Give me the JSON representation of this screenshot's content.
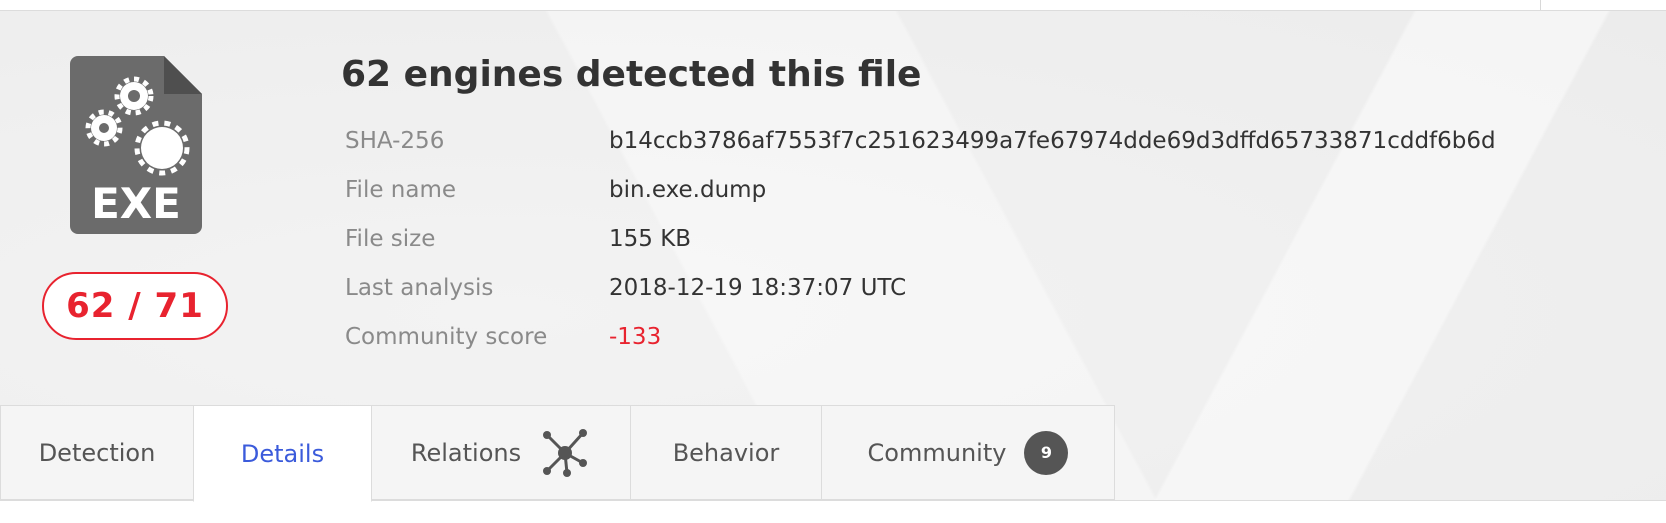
{
  "file": {
    "type_icon": "exe-file-icon",
    "type_label": "EXE",
    "detection_ratio": "62 / 71",
    "title": "62 engines detected this file"
  },
  "properties": [
    {
      "label": "SHA-256",
      "value": "b14ccb3786af7553f7c251623499a7fe67974dde69d3dffd65733871cddf6b6d"
    },
    {
      "label": "File name",
      "value": "bin.exe.dump"
    },
    {
      "label": "File size",
      "value": "155 KB"
    },
    {
      "label": "Last analysis",
      "value": "2018-12-19 18:37:07 UTC"
    },
    {
      "label": "Community score",
      "value": "-133"
    }
  ],
  "tabs": [
    {
      "label": "Detection"
    },
    {
      "label": "Details",
      "active": true
    },
    {
      "label": "Relations",
      "icon": "graph-icon"
    },
    {
      "label": "Behavior"
    },
    {
      "label": "Community",
      "badge": "9"
    }
  ],
  "colors": {
    "alert": "#e8232f",
    "active_tab": "#3b5bdb",
    "icon": "#6b6b6b"
  }
}
